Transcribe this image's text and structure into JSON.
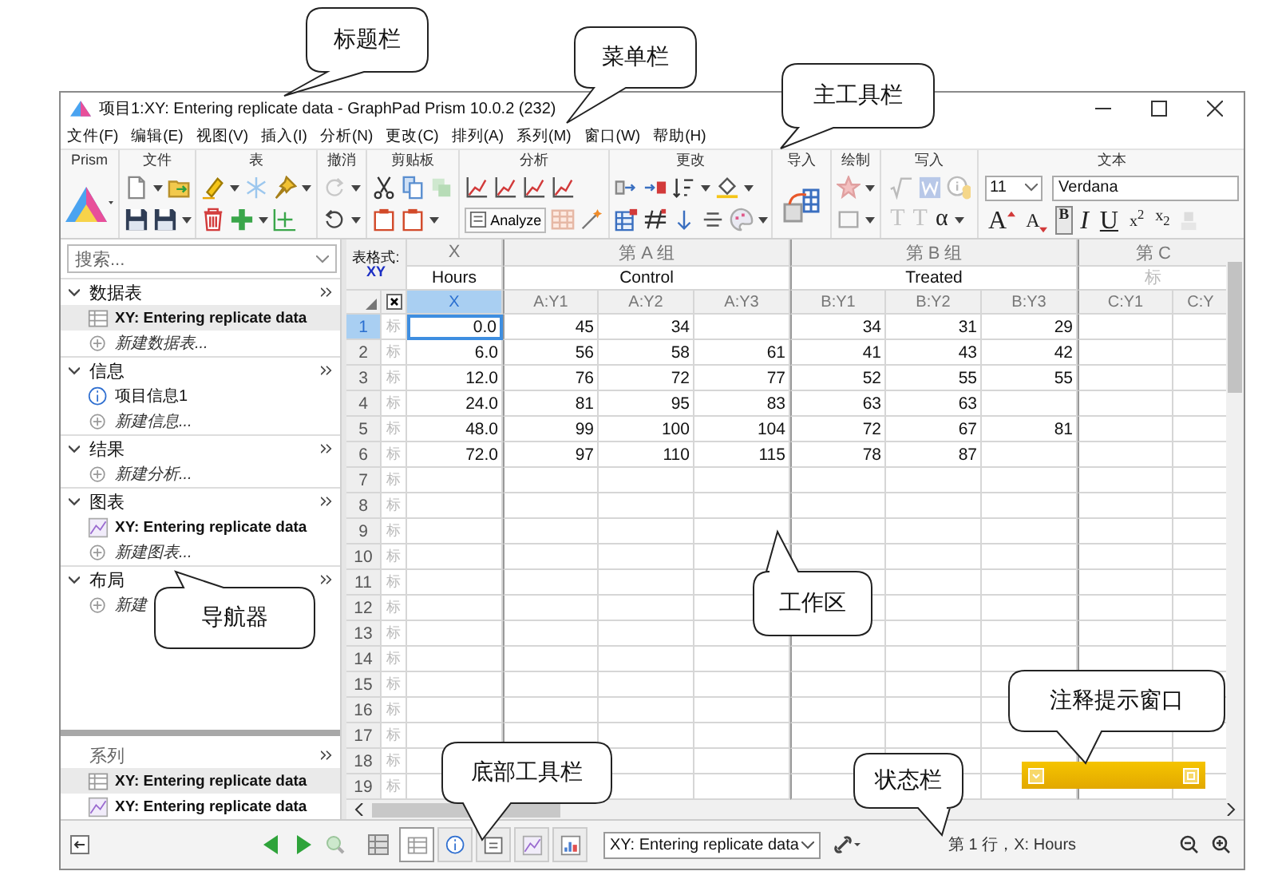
{
  "window": {
    "title": "项目1:XY: Entering replicate data - GraphPad Prism 10.0.2 (232)"
  },
  "menu": [
    "文件(F)",
    "编辑(E)",
    "视图(V)",
    "插入(I)",
    "分析(N)",
    "更改(C)",
    "排列(A)",
    "系列(M)",
    "窗口(W)",
    "帮助(H)"
  ],
  "ribbon": {
    "groups": [
      {
        "label": "Prism"
      },
      {
        "label": "文件"
      },
      {
        "label": "表"
      },
      {
        "label": "撤消"
      },
      {
        "label": "剪贴板"
      },
      {
        "label": "分析",
        "button": "Analyze"
      },
      {
        "label": "更改"
      },
      {
        "label": "导入"
      },
      {
        "label": "绘制"
      },
      {
        "label": "写入"
      },
      {
        "label": "文本"
      }
    ],
    "write_buttons": [
      {
        "label": "T",
        "disabled": true
      },
      {
        "label": "T",
        "disabled": true
      },
      {
        "label": "α",
        "disabled": false
      }
    ],
    "font_size": "11",
    "font_name": "Verdana",
    "format_buttons": [
      {
        "label": "A",
        "kind": "grow",
        "selected": false
      },
      {
        "label": "A",
        "kind": "shrink",
        "selected": false
      },
      {
        "label": "B",
        "kind": "bold",
        "selected": true
      },
      {
        "label": "I",
        "kind": "italic",
        "selected": false
      },
      {
        "label": "U",
        "kind": "underline",
        "selected": false
      },
      {
        "label": "x$^{2}$",
        "kind": "plain",
        "selected": false
      },
      {
        "label": "x$_{2}$",
        "kind": "plain",
        "selected": false
      }
    ]
  },
  "navigator": {
    "search": {
      "placeholder": "搜索..."
    },
    "sections": [
      {
        "title": "数据表",
        "items": [
          {
            "kind": "table",
            "label": "XY: Entering replicate data",
            "selected": true
          },
          {
            "kind": "new",
            "label": "新建数据表...",
            "selected": false
          }
        ]
      },
      {
        "title": "信息",
        "items": [
          {
            "kind": "info",
            "label": "项目信息1",
            "selected": false
          },
          {
            "kind": "new",
            "label": "新建信息...",
            "selected": false
          }
        ]
      },
      {
        "title": "结果",
        "items": [
          {
            "kind": "new",
            "label": "新建分析...",
            "selected": false
          }
        ]
      },
      {
        "title": "图表",
        "items": [
          {
            "kind": "graph",
            "label": "XY: Entering replicate data",
            "selected": false
          },
          {
            "kind": "new",
            "label": "新建图表...",
            "selected": false
          }
        ]
      },
      {
        "title": "布局",
        "items": [
          {
            "kind": "new",
            "label": "新建",
            "selected": false
          }
        ]
      }
    ],
    "family": {
      "title": "系列",
      "items": [
        {
          "kind": "table",
          "label": "XY: Entering replicate data",
          "selected": true
        },
        {
          "kind": "graph",
          "label": "XY: Entering replicate data",
          "selected": false
        }
      ]
    }
  },
  "table": {
    "format_label": "表格式:",
    "format": "XY",
    "groups": [
      {
        "label": "X",
        "title": "Hours",
        "columns": [
          {
            "label": "X",
            "selected": true
          }
        ]
      },
      {
        "label": "第 A 组",
        "title": "Control",
        "columns": [
          {
            "label": "A:Y1",
            "selected": false
          },
          {
            "label": "A:Y2",
            "selected": false
          },
          {
            "label": "A:Y3",
            "selected": false
          }
        ]
      },
      {
        "label": "第 B 组",
        "title": "Treated",
        "columns": [
          {
            "label": "B:Y1",
            "selected": false
          },
          {
            "label": "B:Y2",
            "selected": false
          },
          {
            "label": "B:Y3",
            "selected": false
          }
        ]
      },
      {
        "label": "第 C",
        "placeholder": "标",
        "columns": [
          {
            "label": "C:Y1",
            "selected": false
          },
          {
            "label": "C:Y",
            "selected": false
          }
        ]
      }
    ],
    "rows": [
      {
        "number": "1",
        "placeholder": "标",
        "selected": true,
        "cells": [
          "0.0",
          "45",
          "34",
          null,
          "34",
          "31",
          "29",
          null,
          null
        ]
      },
      {
        "number": "2",
        "placeholder": "标",
        "selected": false,
        "cells": [
          "6.0",
          "56",
          "58",
          "61",
          "41",
          "43",
          "42",
          null,
          null
        ]
      },
      {
        "number": "3",
        "placeholder": "标",
        "selected": false,
        "cells": [
          "12.0",
          "76",
          "72",
          "77",
          "52",
          "55",
          "55",
          null,
          null
        ]
      },
      {
        "number": "4",
        "placeholder": "标",
        "selected": false,
        "cells": [
          "24.0",
          "81",
          "95",
          "83",
          "63",
          "63",
          null,
          null,
          null
        ]
      },
      {
        "number": "5",
        "placeholder": "标",
        "selected": false,
        "cells": [
          "48.0",
          "99",
          "100",
          "104",
          "72",
          "67",
          "81",
          null,
          null
        ]
      },
      {
        "number": "6",
        "placeholder": "标",
        "selected": false,
        "cells": [
          "72.0",
          "97",
          "110",
          "115",
          "78",
          "87",
          null,
          null,
          null
        ]
      },
      {
        "number": "7",
        "placeholder": "标",
        "selected": false
      },
      {
        "number": "8",
        "placeholder": "标",
        "selected": false
      },
      {
        "number": "9",
        "placeholder": "标",
        "selected": false
      },
      {
        "number": "10",
        "placeholder": "标",
        "selected": false
      },
      {
        "number": "11",
        "placeholder": "标",
        "selected": false
      },
      {
        "number": "12",
        "placeholder": "标",
        "selected": false
      },
      {
        "number": "13",
        "placeholder": "标",
        "selected": false
      },
      {
        "number": "14",
        "placeholder": "标",
        "selected": false
      },
      {
        "number": "15",
        "placeholder": "标",
        "selected": false
      },
      {
        "number": "16",
        "placeholder": "标",
        "selected": false
      },
      {
        "number": "17",
        "placeholder": "标",
        "selected": false
      },
      {
        "number": "18",
        "placeholder": "标",
        "selected": false
      },
      {
        "number": "19",
        "placeholder": "标",
        "selected": false
      }
    ]
  },
  "bottom_toolbar": {
    "sheet_tabs": [
      {
        "kind": "table",
        "selected": true
      },
      {
        "kind": "info",
        "selected": false
      },
      {
        "kind": "note",
        "selected": false
      },
      {
        "kind": "graph",
        "selected": false
      },
      {
        "kind": "layout",
        "selected": false
      }
    ],
    "sheet_select": "XY: Entering replicate data"
  },
  "status_bar": {
    "text": "第 1 行，X: Hours"
  },
  "callouts": [
    {
      "label": "标题栏"
    },
    {
      "label": "菜单栏"
    },
    {
      "label": "主工具栏"
    },
    {
      "label": "导航器"
    },
    {
      "label": "工作区"
    },
    {
      "label": "注释提示窗口"
    },
    {
      "label": "底部工具栏"
    },
    {
      "label": "状态栏"
    }
  ]
}
